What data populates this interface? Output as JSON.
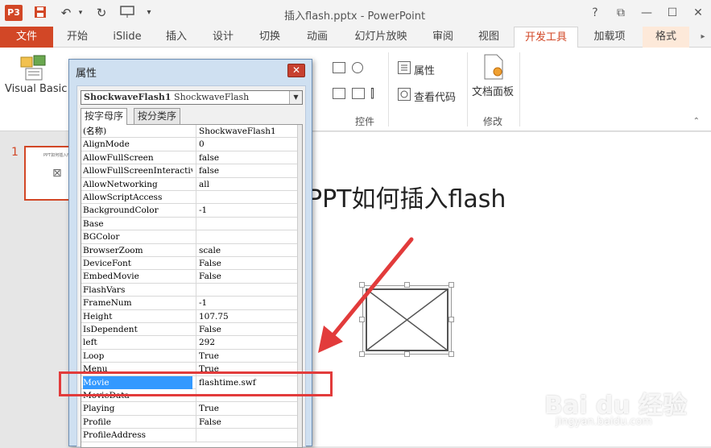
{
  "window": {
    "title": "插入flash.pptx - PowerPoint",
    "app_logo": "P3",
    "controls": [
      "?",
      "⧉",
      "—",
      "☐",
      "✕"
    ]
  },
  "qat": {
    "icons": [
      "save-icon",
      "undo-icon",
      "redo-icon",
      "slideshow-icon",
      "customize-icon"
    ]
  },
  "ribbon_tabs": [
    {
      "label": "文件"
    },
    {
      "label": "开始"
    },
    {
      "label": "iSlide"
    },
    {
      "label": "插入"
    },
    {
      "label": "设计"
    },
    {
      "label": "切换"
    },
    {
      "label": "动画"
    },
    {
      "label": "幻灯片放映"
    },
    {
      "label": "审阅"
    },
    {
      "label": "视图"
    },
    {
      "label": "开发工具",
      "active": true
    },
    {
      "label": "加载项"
    },
    {
      "label": "格式"
    }
  ],
  "ribbon": {
    "visual_basic": "Visual Basic",
    "properties": "属性",
    "view_code": "查看代码",
    "controls_group": "控件",
    "doc_panel": "文档面板",
    "modify_group": "修改"
  },
  "thumbnail": {
    "number": "1",
    "title": "PPT如何插入flash"
  },
  "slide": {
    "title": "PPT如何插入flash"
  },
  "dialog": {
    "title": "属性",
    "object_name": "ShockwaveFlash1",
    "object_type": "ShockwaveFlash",
    "tab_alpha": "按字母序",
    "tab_category": "按分类序",
    "props": [
      {
        "name": "(名称)",
        "value": "ShockwaveFlash1"
      },
      {
        "name": "AlignMode",
        "value": "0"
      },
      {
        "name": "AllowFullScreen",
        "value": "false"
      },
      {
        "name": "AllowFullScreenInteractive",
        "value": "false"
      },
      {
        "name": "AllowNetworking",
        "value": "all"
      },
      {
        "name": "AllowScriptAccess",
        "value": ""
      },
      {
        "name": "BackgroundColor",
        "value": "-1"
      },
      {
        "name": "Base",
        "value": ""
      },
      {
        "name": "BGColor",
        "value": ""
      },
      {
        "name": "BrowserZoom",
        "value": "scale"
      },
      {
        "name": "DeviceFont",
        "value": "False"
      },
      {
        "name": "EmbedMovie",
        "value": "False"
      },
      {
        "name": "FlashVars",
        "value": ""
      },
      {
        "name": "FrameNum",
        "value": "-1"
      },
      {
        "name": "Height",
        "value": "107.75"
      },
      {
        "name": "IsDependent",
        "value": "False"
      },
      {
        "name": "left",
        "value": "292"
      },
      {
        "name": "Loop",
        "value": "True"
      },
      {
        "name": "Menu",
        "value": "True"
      },
      {
        "name": "Movie",
        "value": "flashtime.swf",
        "selected": true
      },
      {
        "name": "MovieData",
        "value": ""
      },
      {
        "name": "Playing",
        "value": "True"
      },
      {
        "name": "Profile",
        "value": "False"
      },
      {
        "name": "ProfileAddress",
        "value": ""
      }
    ]
  },
  "watermark": {
    "brand": "Bai du 经验",
    "site": "jingyan.baidu.com"
  },
  "colors": {
    "accent": "#d24726",
    "selection": "#3399ff",
    "annotation": "#e23b3b"
  }
}
